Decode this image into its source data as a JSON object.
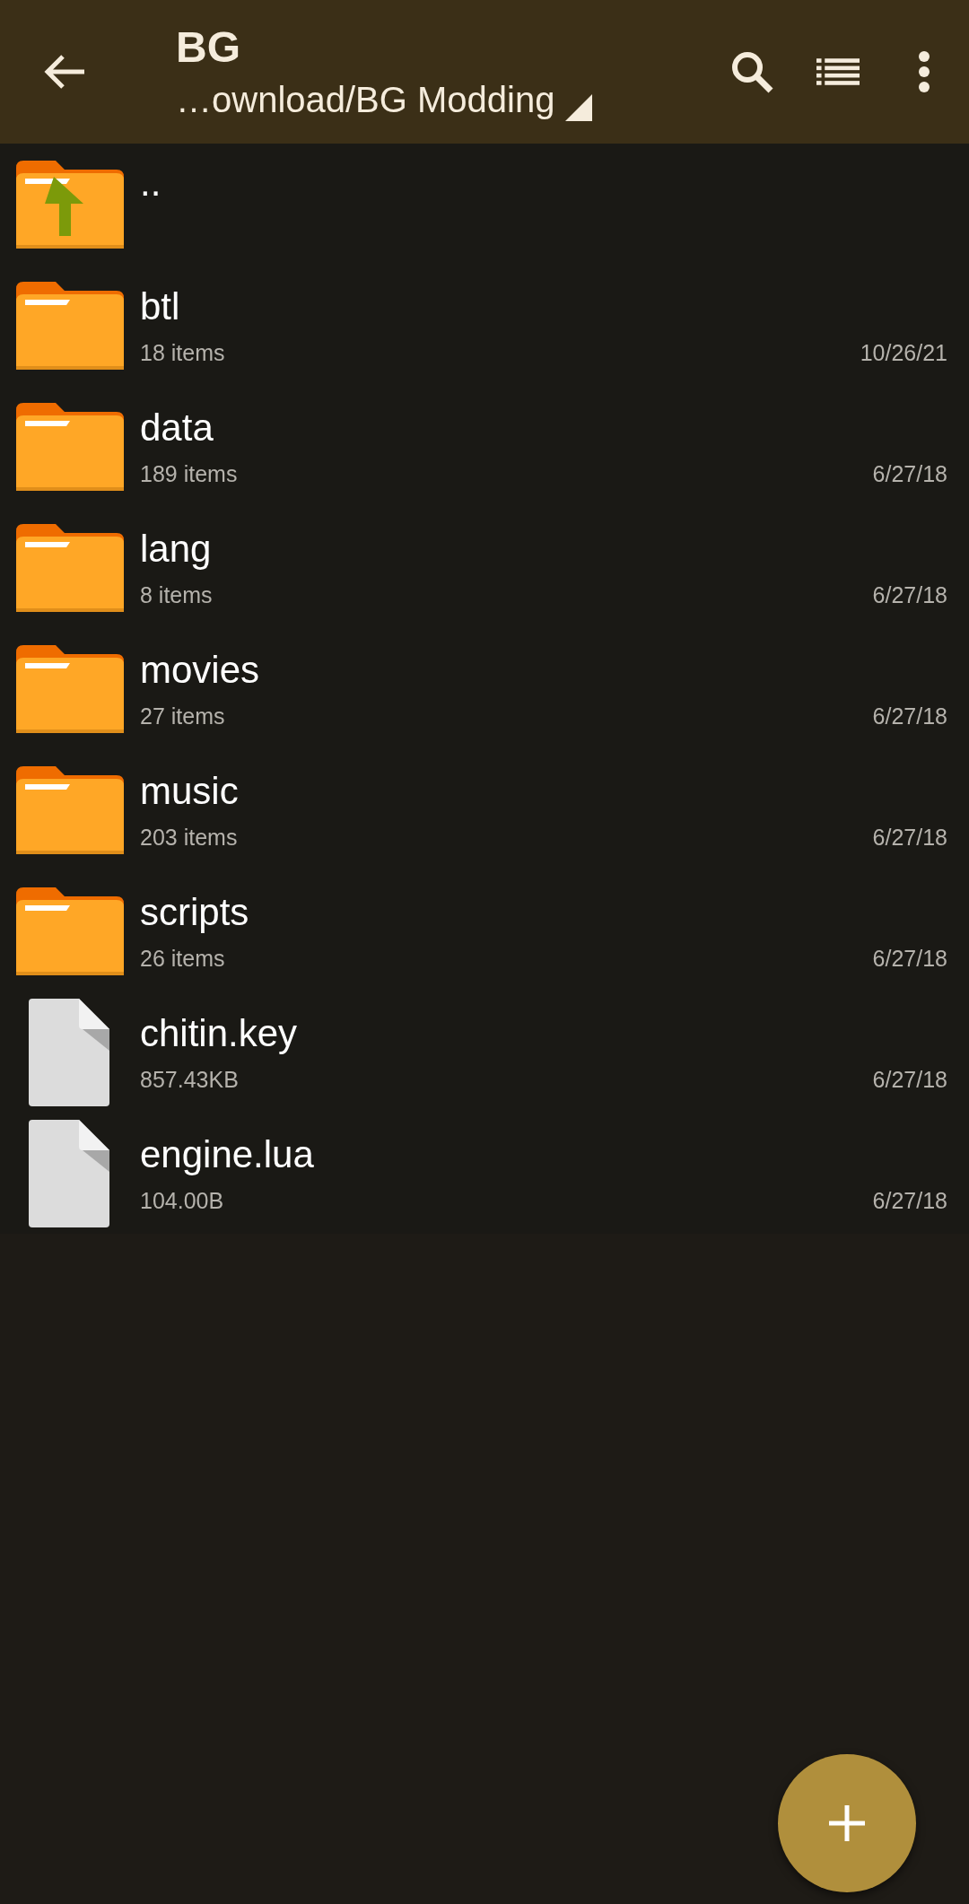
{
  "toolbar": {
    "title": "BG",
    "path": "…ownload/BG Modding"
  },
  "files": [
    {
      "kind": "up",
      "name": ".."
    },
    {
      "kind": "folder",
      "name": "btl",
      "info": "18 items",
      "date": "10/26/21"
    },
    {
      "kind": "folder",
      "name": "data",
      "info": "189 items",
      "date": "6/27/18"
    },
    {
      "kind": "folder",
      "name": "lang",
      "info": "8 items",
      "date": "6/27/18"
    },
    {
      "kind": "folder",
      "name": "movies",
      "info": "27 items",
      "date": "6/27/18"
    },
    {
      "kind": "folder",
      "name": "music",
      "info": "203 items",
      "date": "6/27/18"
    },
    {
      "kind": "folder",
      "name": "scripts",
      "info": "26 items",
      "date": "6/27/18"
    },
    {
      "kind": "file",
      "name": "chitin.key",
      "info": "857.43KB",
      "date": "6/27/18"
    },
    {
      "kind": "file",
      "name": "engine.lua",
      "info": "104.00B",
      "date": "6/27/18"
    }
  ]
}
